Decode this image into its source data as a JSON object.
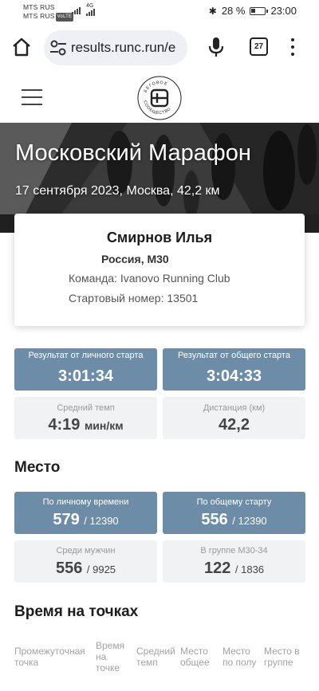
{
  "status": {
    "carrier1": "MTS RUS",
    "carrier2": "MTS RUS",
    "volte": "VoLTE",
    "network": "4G",
    "battery": "28 %",
    "time": "23:00"
  },
  "browser": {
    "url": "results.runc.run/e",
    "tab_count": "27"
  },
  "logo": {
    "text_top": "БЕГОВОЕ",
    "text_bottom": "СООБЩЕСТВО"
  },
  "event": {
    "title": "Московский Марафон",
    "subtitle": "17 сентября 2023, Москва, 42,2 км"
  },
  "runner": {
    "name": "Смирнов Илья",
    "country_group": "Россия, M30",
    "team": "Команда: Ivanovo Running Club",
    "bib": "Стартовый номер: 13501"
  },
  "results": {
    "net_label": "Результат от личного старта",
    "net_value": "3:01:34",
    "gun_label": "Результат от общего старта",
    "gun_value": "3:04:33",
    "pace_label": "Средний темп",
    "pace_value": "4:19",
    "pace_unit": "мин/км",
    "distance_label": "Дистанция (км)",
    "distance_value": "42,2"
  },
  "place": {
    "title": "Место",
    "net_label": "По личному времени",
    "net_value": "579",
    "net_total": "/ 12390",
    "gun_label": "По общему старту",
    "gun_value": "556",
    "gun_total": "/ 12390",
    "gender_label": "Среди мужчин",
    "gender_value": "556",
    "gender_total": "/ 9925",
    "group_label": "В группе M30-34",
    "group_value": "122",
    "group_total": "/ 1836"
  },
  "splits": {
    "title": "Время на точках",
    "columns": [
      "Промежуточная точка",
      "Время на точке",
      "Средний темп",
      "Место общее",
      "Место по полу",
      "Место в группе"
    ]
  },
  "colors": {
    "accent_tile": "#6c8ca7",
    "light_tile": "#f1f2f4"
  }
}
